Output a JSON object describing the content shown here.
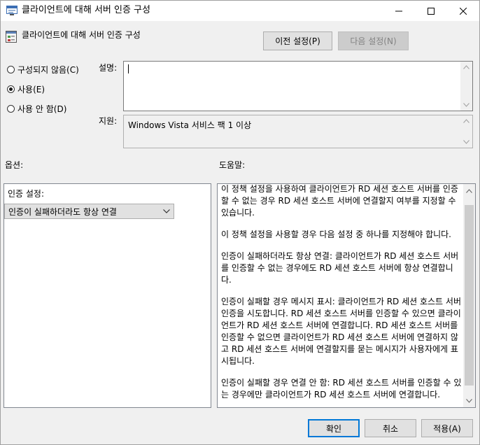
{
  "window": {
    "title": "클라이언트에 대해 서버 인증 구성"
  },
  "header": {
    "policy_name": "클라이언트에 대해 서버 인증 구성",
    "prev_button": "이전 설정(P)",
    "next_button": "다음 설정(N)"
  },
  "state": {
    "options": [
      {
        "label": "구성되지 않음(C)",
        "checked": false
      },
      {
        "label": "사용(E)",
        "checked": true
      },
      {
        "label": "사용 안 함(D)",
        "checked": false
      }
    ]
  },
  "comment": {
    "label": "설명:",
    "value": ""
  },
  "supported": {
    "label": "지원:",
    "value": "Windows Vista 서비스 팩 1 이상"
  },
  "options_section": {
    "label": "옵션:",
    "auth_setting_label": "인증 설정:",
    "auth_setting_value": "인증이 실패하더라도 항상 연결"
  },
  "help_section": {
    "label": "도움말:",
    "paragraphs": [
      "이 정책 설정을 사용하여 클라이언트가 RD 세션 호스트 서버를 인증할 수 없는 경우 RD 세션 호스트 서버에 연결할지 여부를 지정할 수 있습니다.",
      "이 정책 설정을 사용할 경우 다음 설정 중 하나를 지정해야 합니다.",
      "인증이 실패하더라도 항상 연결: 클라이언트가 RD 세션 호스트 서버를 인증할 수 없는 경우에도 RD 세션 호스트 서버에 항상 연결합니다.",
      "인증이 실패할 경우 메시지 표시: 클라이언트가 RD 세션 호스트 서버 인증을 시도합니다. RD 세션 호스트 서버를 인증할 수 있으면 클라이언트가 RD 세션 호스트 서버에 연결합니다. RD 세션 호스트 서버를 인증할 수 없으면 클라이언트가 RD 세션 호스트 서버에 연결하지 않고 RD 세션 호스트 서버에 연결할지를 묻는 메시지가 사용자에게 표시됩니다.",
      "인증이 실패할 경우 연결 안 함: RD 세션 호스트 서버를 인증할 수 있는 경우에만 클라이언트가 RD 세션 호스트 서버에 연결합니다."
    ]
  },
  "footer": {
    "ok": "확인",
    "cancel": "취소",
    "apply": "적용(A)"
  },
  "icons": {
    "title_icon": "policy-window-icon",
    "header_icon": "policy-setting-icon",
    "minimize": "minimize-icon",
    "maximize": "maximize-icon",
    "close": "close-icon",
    "dropdown": "chevron-down-icon"
  },
  "colors": {
    "default_button_border": "#0078d7",
    "window_background": "#f0f0f0"
  }
}
